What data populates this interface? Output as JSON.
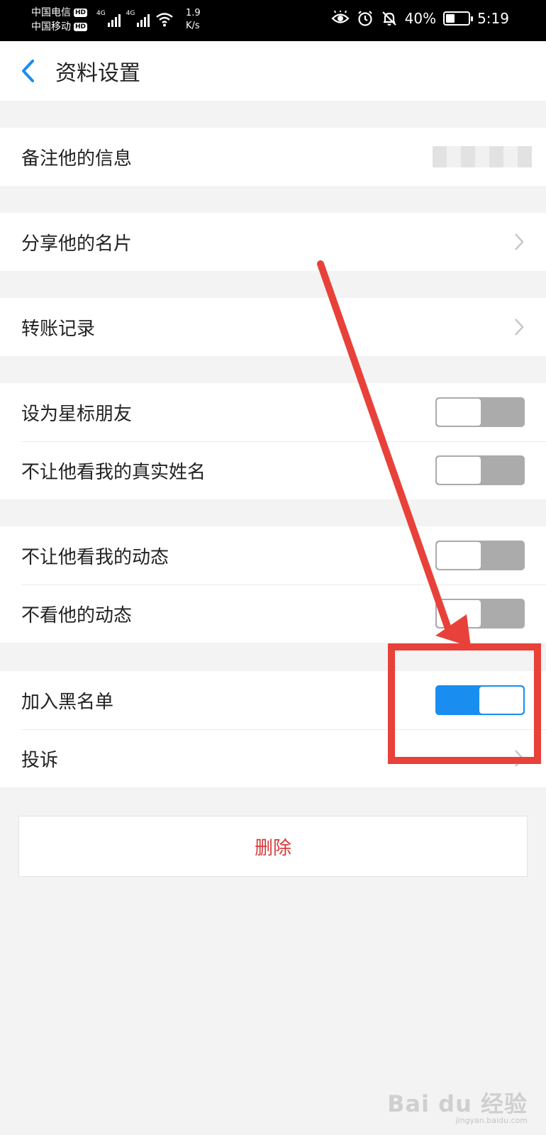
{
  "status_bar": {
    "carrier_1": "中国电信",
    "carrier_2": "中国移动",
    "hd_badge": "HD",
    "network_type": "4G",
    "speed_value": "1.9",
    "speed_unit": "K/s",
    "battery_percent": "40%",
    "battery_level": 0.4,
    "time": "5:19",
    "icons": [
      "eye-icon",
      "alarm-icon",
      "bell-muted-icon",
      "wifi-icon",
      "battery-icon"
    ]
  },
  "header": {
    "back_icon": "chevron-left-icon",
    "title": "资料设置",
    "accent_color": "#1a8df0"
  },
  "sections": [
    {
      "rows": [
        {
          "label": "备注他的信息",
          "accessory": "blurred-value"
        }
      ]
    },
    {
      "rows": [
        {
          "label": "分享他的名片",
          "accessory": "chevron"
        }
      ]
    },
    {
      "rows": [
        {
          "label": "转账记录",
          "accessory": "chevron"
        }
      ]
    },
    {
      "rows": [
        {
          "label": "设为星标朋友",
          "accessory": "toggle",
          "on": false
        },
        {
          "label": "不让他看我的真实姓名",
          "accessory": "toggle",
          "on": false
        }
      ]
    },
    {
      "rows": [
        {
          "label": "不让他看我的动态",
          "accessory": "toggle",
          "on": false
        },
        {
          "label": "不看他的动态",
          "accessory": "toggle",
          "on": false
        }
      ]
    },
    {
      "rows": [
        {
          "label": "加入黑名单",
          "accessory": "toggle",
          "on": true
        },
        {
          "label": "投诉",
          "accessory": "chevron"
        }
      ]
    }
  ],
  "delete_button": {
    "label": "删除",
    "color": "#d63b3b"
  },
  "annotation": {
    "color": "#e8413a",
    "type": "arrow-and-box"
  },
  "watermark": {
    "logo": "Bai du 经验",
    "sub": "jingyan.baidu.com"
  }
}
